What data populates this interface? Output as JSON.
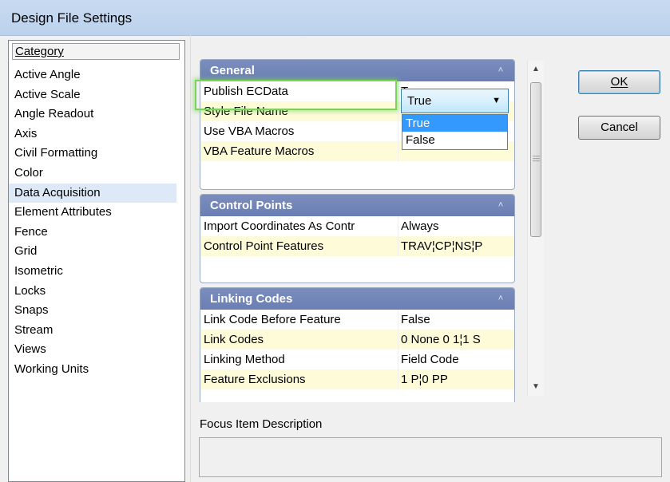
{
  "window": {
    "title": "Design File Settings"
  },
  "category": {
    "header": "Category",
    "items": [
      "Active Angle",
      "Active Scale",
      "Angle Readout",
      "Axis",
      "Civil Formatting",
      "Color",
      "Data Acquisition",
      "Element Attributes",
      "Fence",
      "Grid",
      "Isometric",
      "Locks",
      "Snaps",
      "Stream",
      "Views",
      "Working Units"
    ],
    "selected": "Data Acquisition"
  },
  "groups": {
    "general": {
      "title": "General",
      "rows": [
        {
          "name": "Publish ECData",
          "value": "True"
        },
        {
          "name": "Style File Name",
          "value": ""
        },
        {
          "name": "Use VBA Macros",
          "value": ""
        },
        {
          "name": "VBA Feature Macros",
          "value": ""
        }
      ]
    },
    "control_points": {
      "title": "Control Points",
      "rows": [
        {
          "name": "Import Coordinates As Contr",
          "value": "Always"
        },
        {
          "name": "Control Point Features",
          "value": "TRAV¦CP¦NS¦P"
        }
      ]
    },
    "linking_codes": {
      "title": "Linking Codes",
      "rows": [
        {
          "name": "Link Code Before Feature",
          "value": "False"
        },
        {
          "name": "Link Codes",
          "value": "0 None 0 1¦1 S"
        },
        {
          "name": "Linking Method",
          "value": "Field Code"
        },
        {
          "name": "Feature  Exclusions",
          "value": "1 P¦0 PP"
        }
      ]
    }
  },
  "combo": {
    "value": "True",
    "options": [
      "True",
      "False"
    ],
    "highlighted": "True"
  },
  "buttons": {
    "ok": "OK",
    "cancel": "Cancel"
  },
  "focus": {
    "label": "Focus Item Description",
    "text": ""
  }
}
